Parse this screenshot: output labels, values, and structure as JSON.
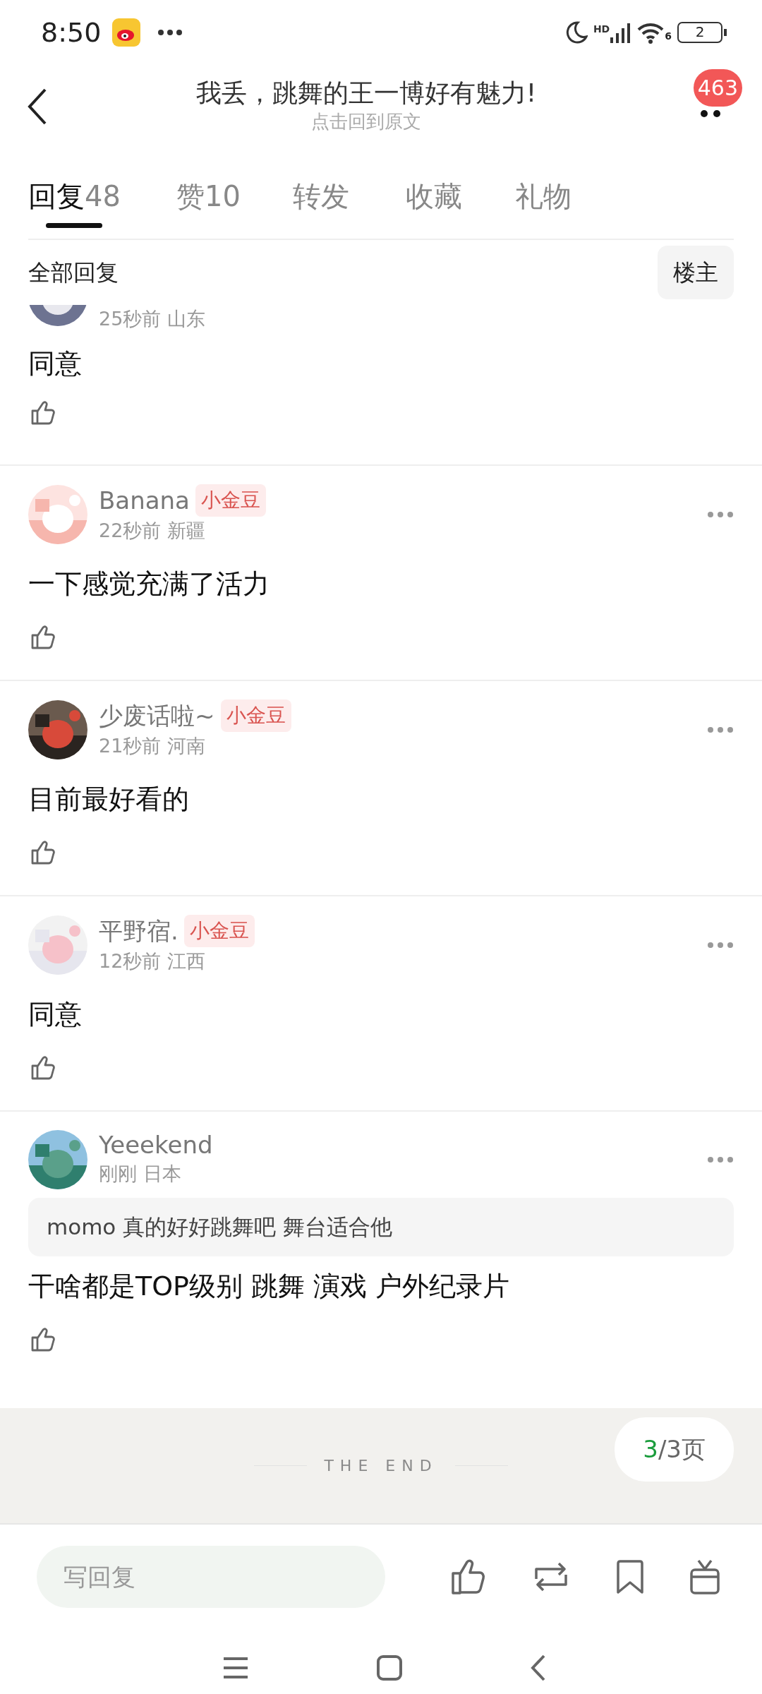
{
  "status_bar": {
    "time": "8:50",
    "signal_label": "HD",
    "wifi_label": "6",
    "battery": "2"
  },
  "header": {
    "title": "我丢，跳舞的王一博好有魅力!",
    "subtitle": "点击回到原文",
    "badge": "463"
  },
  "tabs": [
    {
      "label": "回复",
      "count": "48",
      "selected": true
    },
    {
      "label": "赞",
      "count": "10",
      "selected": false
    },
    {
      "label": "转发",
      "selected": false
    },
    {
      "label": "收藏",
      "selected": false
    },
    {
      "label": "礼物",
      "selected": false
    }
  ],
  "filter": {
    "label": "全部回复",
    "button": "楼主"
  },
  "comments": [
    {
      "time": "25秒前",
      "location": "山东",
      "text": "同意"
    },
    {
      "name": "Banana",
      "tag": "小金豆",
      "time": "22秒前",
      "location": "新疆",
      "text": "一下感觉充满了活力"
    },
    {
      "name": "少废话啦~",
      "tag": "小金豆",
      "time": "21秒前",
      "location": "河南",
      "text": "目前最好看的"
    },
    {
      "name": "平野宿.",
      "tag": "小金豆",
      "time": "12秒前",
      "location": "江西",
      "text": "同意"
    },
    {
      "name": "Yeeekend",
      "time": "刚刚",
      "location": "日本",
      "quote": "momo 真的好好跳舞吧 舞台适合他",
      "text": "干啥都是TOP级别 跳舞 演戏 户外纪录片"
    }
  ],
  "end_label": "THE END",
  "pager": {
    "current": "3",
    "total": "/3页"
  },
  "reply_field": {
    "placeholder": "写回复"
  }
}
